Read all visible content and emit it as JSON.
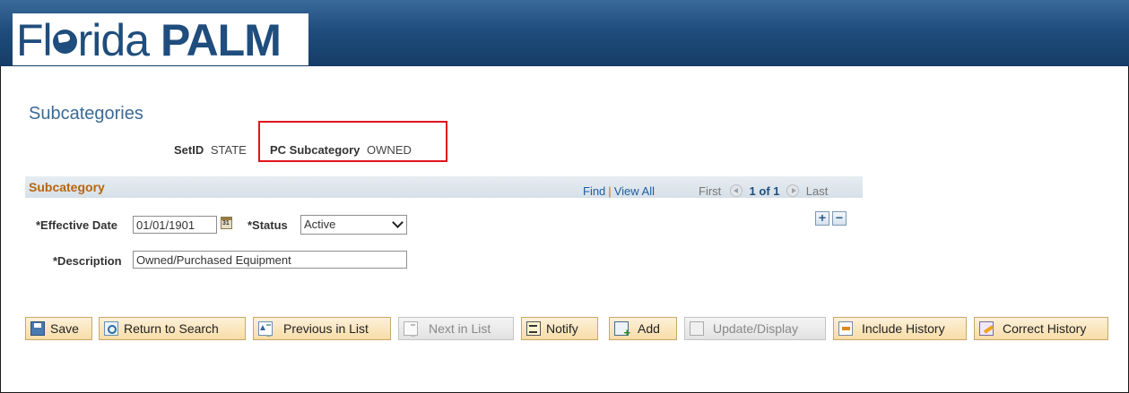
{
  "app": {
    "logo_light": "Fl",
    "logo_light2": "rida",
    "logo_bold": "PALM"
  },
  "page": {
    "title": "Subcategories"
  },
  "keys": {
    "setid_label": "SetID",
    "setid_value": "STATE",
    "subcategory_label": "PC Subcategory",
    "subcategory_value": "OWNED"
  },
  "section": {
    "title": "Subcategory",
    "find": "Find",
    "view_all": "View All",
    "first": "First",
    "count": "1 of 1",
    "last": "Last"
  },
  "form": {
    "effective_date_label": "*Effective Date",
    "effective_date_value": "01/01/1901",
    "status_label": "*Status",
    "status_value": "Active",
    "description_label": "*Description",
    "description_value": "Owned/Purchased Equipment"
  },
  "toolbar": {
    "save": "Save",
    "return_to_search": "Return to Search",
    "previous_in_list": "Previous in List",
    "next_in_list": "Next in List",
    "notify": "Notify",
    "add": "Add",
    "update_display": "Update/Display",
    "include_history": "Include History",
    "correct_history": "Correct History"
  },
  "colors": {
    "banner": "#1f4d7d",
    "section_title": "#b8660c",
    "highlight": "#e0141e",
    "button_bg": "#f7dca6"
  }
}
